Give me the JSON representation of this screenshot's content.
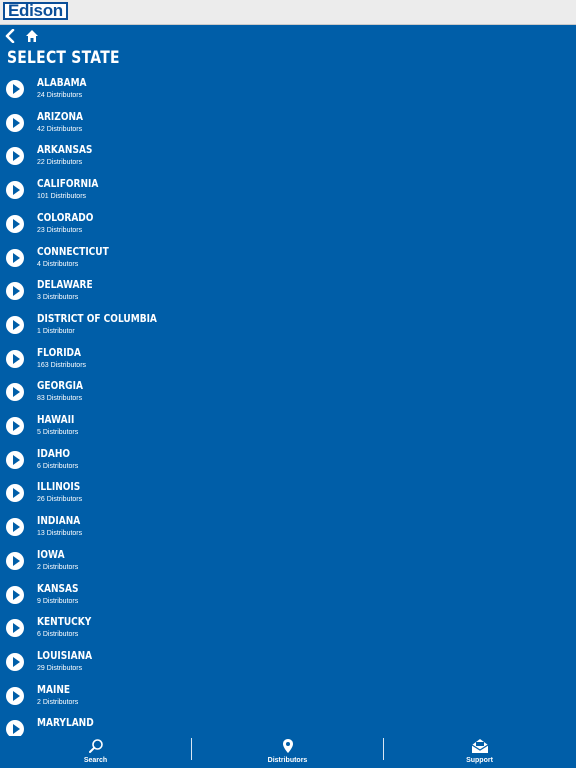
{
  "app": {
    "logo_text": "Edison"
  },
  "nav": {
    "back_icon": "chevron-left-icon",
    "home_icon": "home-icon"
  },
  "page": {
    "title": "SELECT STATE"
  },
  "states": [
    {
      "name": "ALABAMA",
      "count": "24 Distributors"
    },
    {
      "name": "ARIZONA",
      "count": "42 Distributors"
    },
    {
      "name": "ARKANSAS",
      "count": "22 Distributors"
    },
    {
      "name": "CALIFORNIA",
      "count": "101 Distributors"
    },
    {
      "name": "COLORADO",
      "count": "23 Distributors"
    },
    {
      "name": "CONNECTICUT",
      "count": "4 Distributors"
    },
    {
      "name": "DELAWARE",
      "count": "3 Distributors"
    },
    {
      "name": "DISTRICT OF COLUMBIA",
      "count": "1 Distributor"
    },
    {
      "name": "FLORIDA",
      "count": "163 Distributors"
    },
    {
      "name": "GEORGIA",
      "count": "83 Distributors"
    },
    {
      "name": "HAWAII",
      "count": "5 Distributors"
    },
    {
      "name": "IDAHO",
      "count": "6 Distributors"
    },
    {
      "name": "ILLINOIS",
      "count": "26 Distributors"
    },
    {
      "name": "INDIANA",
      "count": "13 Distributors"
    },
    {
      "name": "IOWA",
      "count": "2 Distributors"
    },
    {
      "name": "KANSAS",
      "count": "9 Distributors"
    },
    {
      "name": "KENTUCKY",
      "count": "6 Distributors"
    },
    {
      "name": "LOUISIANA",
      "count": "29 Distributors"
    },
    {
      "name": "MAINE",
      "count": "2 Distributors"
    },
    {
      "name": "MARYLAND",
      "count": ""
    }
  ],
  "tabbar": {
    "search_label": "Search",
    "distributors_label": "Distributors",
    "support_label": "Support"
  },
  "colors": {
    "background": "#005ea8",
    "text": "#ffffff",
    "topbar": "#ececec",
    "logo": "#0b4f99"
  }
}
